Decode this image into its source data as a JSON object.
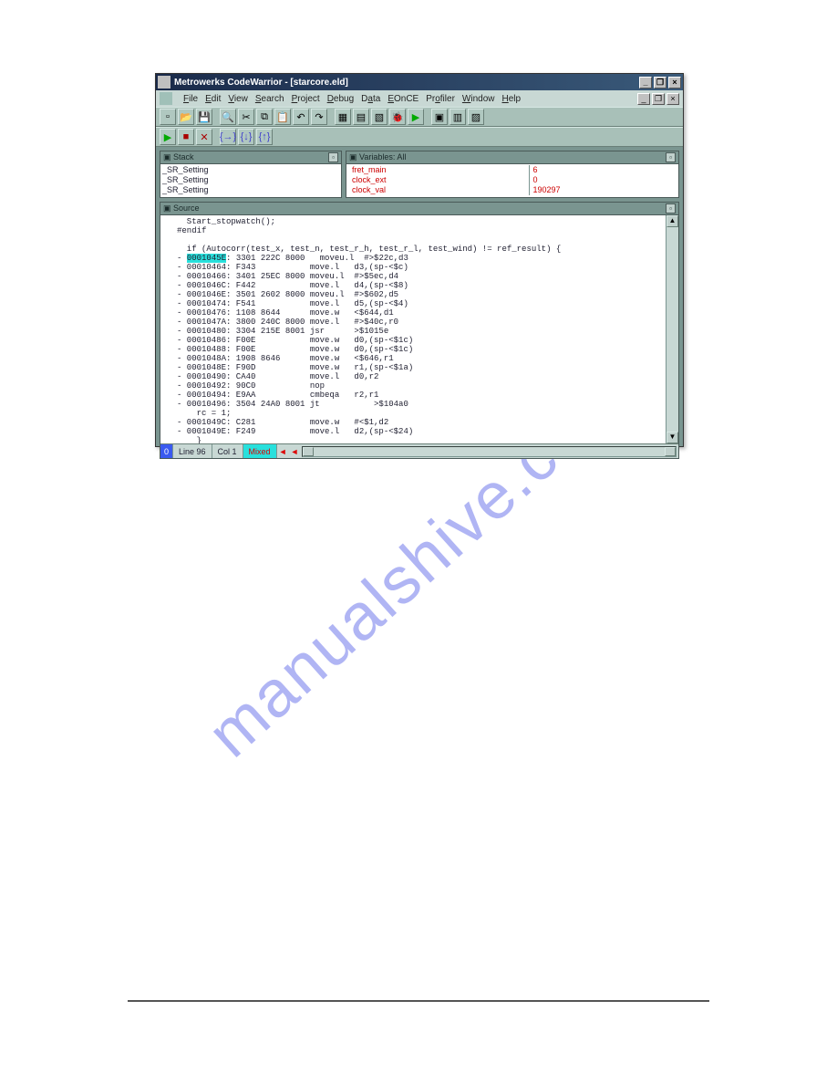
{
  "watermark": "manualshive.com",
  "window": {
    "title": "Metrowerks CodeWarrior - [starcore.eld]",
    "minimize": "_",
    "restore": "❐",
    "close": "×"
  },
  "menu": {
    "file": "File",
    "edit": "Edit",
    "view": "View",
    "search": "Search",
    "project": "Project",
    "debug": "Debug",
    "data": "Data",
    "eonce": "EOnCE",
    "profiler": "Profiler",
    "window": "Window",
    "help": "Help"
  },
  "toolbar": {
    "icons": [
      "new",
      "open",
      "save",
      "find",
      "cut",
      "copy",
      "paste",
      "undo",
      "redo",
      "project",
      "compile",
      "make",
      "debug",
      "run",
      "kill",
      "browse",
      "pane1",
      "pane2"
    ],
    "run_icons": [
      "run",
      "stop",
      "kill",
      "step-over",
      "step-into",
      "step-out"
    ]
  },
  "stack_panel": {
    "title": "Stack",
    "items": [
      "_SR_Setting",
      "_SR_Setting",
      "_SR_Setting"
    ]
  },
  "variables_panel": {
    "title": "Variables: All",
    "rows": [
      {
        "name": "fret_main",
        "value": "6"
      },
      {
        "name": "clock_ext",
        "value": "0"
      },
      {
        "name": "clock_val",
        "value": "190297"
      }
    ]
  },
  "source_panel": {
    "title": "Source",
    "code_pre": "  Start_stopwatch();\n#endif\n\n  if (Autocorr(test_x, test_n, test_r_h, test_r_l, test_wind) != ref_result) {",
    "highlight_addr": "0001045E",
    "code_after_hl": ": 3301 222C 8000   moveu.l  #>$22c,d3\n- 00010464: F343           move.l   d3,(sp-<$c)\n- 00010466: 3401 25EC 8000 moveu.l  #>$5ec,d4\n- 0001046C: F442           move.l   d4,(sp-<$8)\n- 0001046E: 3501 2602 8000 moveu.l  #>$602,d5\n- 00010474: F541           move.l   d5,(sp-<$4)\n- 00010476: 1108 8644      move.w   <$644,d1\n- 0001047A: 3800 240C 8000 move.l   #>$40c,r0\n- 00010480: 3304 215E 8001 jsr      >$1015e\n- 00010486: F00E           move.w   d0,(sp-<$1c)\n- 00010488: F00E           move.w   d0,(sp-<$1c)\n- 0001048A: 1908 8646      move.w   <$646,r1\n- 0001048E: F90D           move.w   r1,(sp-<$1a)\n- 00010490: CA40           move.l   d0,r2\n- 00010492: 90C0           nop\n- 00010494: E9AA           cmbeqa   r2,r1\n- 00010496: 3504 24A0 8001 jt           >$104a0\n    rc = 1;\n- 0001049C: C281           move.w   #<$1,d2\n- 0001049E: F249           move.l   d2,(sp-<$24)\n    }\n\n #if STOPWATCH"
  },
  "statusbar": {
    "indicator": "0",
    "line": "Line 96",
    "col": "Col 1",
    "mode": "Mixed",
    "left_arrow": "◄",
    "right_arrow": "◄"
  }
}
